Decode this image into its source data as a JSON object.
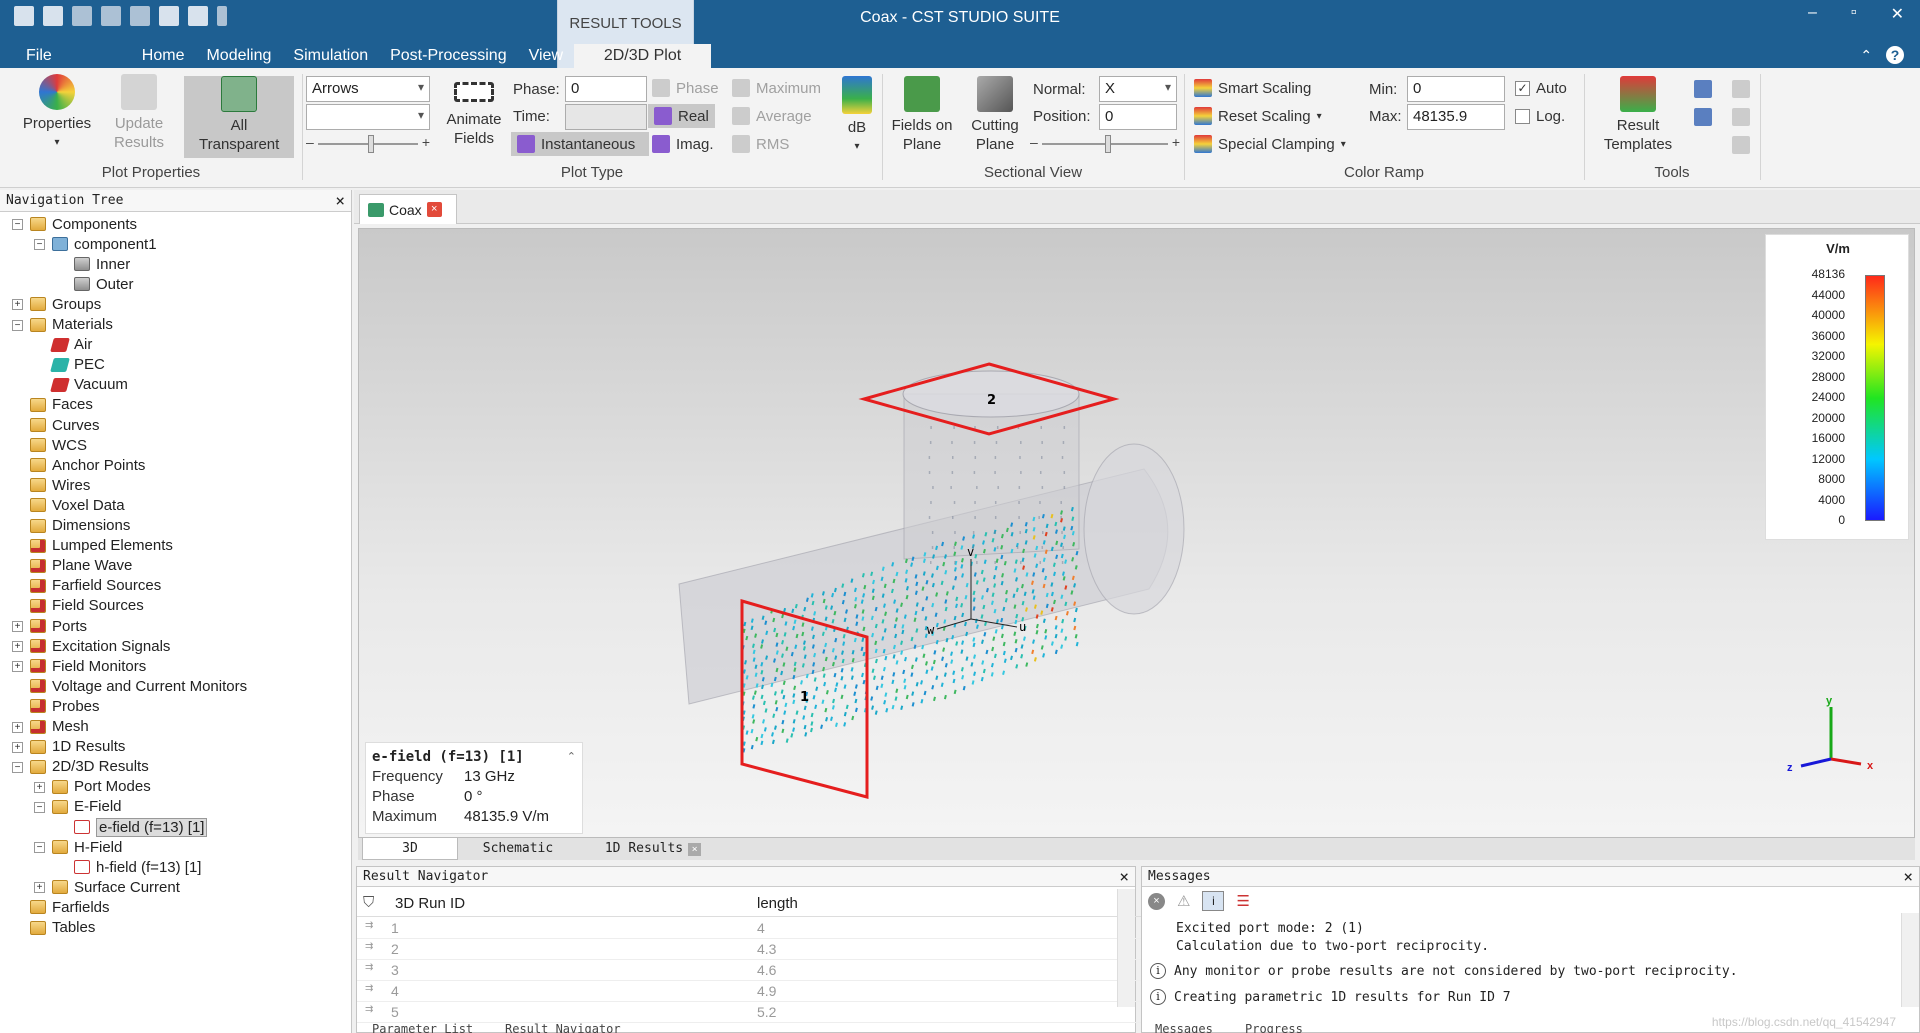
{
  "window": {
    "title": "Coax - CST STUDIO SUITE",
    "minimize": "–",
    "restore": "▫",
    "close": "✕",
    "ribbon_collapse": "⌃",
    "help": "?"
  },
  "context_tab": {
    "group": "RESULT TOOLS",
    "tab": "2D/3D Plot"
  },
  "menu": [
    "File",
    "Home",
    "Modeling",
    "Simulation",
    "Post-Processing",
    "View"
  ],
  "ribbon": {
    "plot_properties": {
      "label": "Plot Properties",
      "properties": "Properties",
      "update_results": "Update Results",
      "all_transparent": "All Transparent"
    },
    "plot_type": {
      "label": "Plot Type",
      "type_value": "Arrows",
      "second_value": "",
      "animate_fields": "Animate Fields",
      "phase_label": "Phase:",
      "phase_value": "0",
      "time_label": "Time:",
      "time_value": "",
      "instantaneous": "Instantaneous",
      "phase": "Phase",
      "real": "Real",
      "imag": "Imag.",
      "maximum": "Maximum",
      "average": "Average",
      "rms": "RMS",
      "db": "dB"
    },
    "sectional_view": {
      "label": "Sectional View",
      "fields_on_plane": "Fields on Plane",
      "cutting_plane": "Cutting Plane",
      "normal_label": "Normal:",
      "normal_value": "X",
      "position_label": "Position:",
      "position_value": "0"
    },
    "color_ramp": {
      "label": "Color Ramp",
      "smart_scaling": "Smart Scaling",
      "reset_scaling": "Reset Scaling",
      "special_clamping": "Special Clamping",
      "min_label": "Min:",
      "min_value": "0",
      "max_label": "Max:",
      "max_value": "48135.9",
      "auto": "Auto",
      "auto_checked": true,
      "log": "Log.",
      "log_checked": false
    },
    "tools": {
      "label": "Tools",
      "result_templates": "Result Templates"
    }
  },
  "nav_tree": {
    "title": "Navigation Tree",
    "items": [
      {
        "label": "Components",
        "level": 0,
        "exp": "−",
        "icon": "folder"
      },
      {
        "label": "component1",
        "level": 1,
        "exp": "−",
        "icon": "comp"
      },
      {
        "label": "Inner",
        "level": 2,
        "exp": "",
        "icon": "solid"
      },
      {
        "label": "Outer",
        "level": 2,
        "exp": "",
        "icon": "solid"
      },
      {
        "label": "Groups",
        "level": 0,
        "exp": "+",
        "icon": "folder"
      },
      {
        "label": "Materials",
        "level": 0,
        "exp": "−",
        "icon": "folder"
      },
      {
        "label": "Air",
        "level": 1,
        "exp": "",
        "icon": "mat-red"
      },
      {
        "label": "PEC",
        "level": 1,
        "exp": "",
        "icon": "mat-teal"
      },
      {
        "label": "Vacuum",
        "level": 1,
        "exp": "",
        "icon": "mat-red"
      },
      {
        "label": "Faces",
        "level": 0,
        "exp": "",
        "icon": "folder"
      },
      {
        "label": "Curves",
        "level": 0,
        "exp": "",
        "icon": "folder"
      },
      {
        "label": "WCS",
        "level": 0,
        "exp": "",
        "icon": "folder"
      },
      {
        "label": "Anchor Points",
        "level": 0,
        "exp": "",
        "icon": "folder"
      },
      {
        "label": "Wires",
        "level": 0,
        "exp": "",
        "icon": "folder"
      },
      {
        "label": "Voxel Data",
        "level": 0,
        "exp": "",
        "icon": "folder"
      },
      {
        "label": "Dimensions",
        "level": 0,
        "exp": "",
        "icon": "folder"
      },
      {
        "label": "Lumped Elements",
        "level": 0,
        "exp": "",
        "icon": "folder-red"
      },
      {
        "label": "Plane Wave",
        "level": 0,
        "exp": "",
        "icon": "folder-red"
      },
      {
        "label": "Farfield Sources",
        "level": 0,
        "exp": "",
        "icon": "folder-red"
      },
      {
        "label": "Field Sources",
        "level": 0,
        "exp": "",
        "icon": "folder-red"
      },
      {
        "label": "Ports",
        "level": 0,
        "exp": "+",
        "icon": "folder-red"
      },
      {
        "label": "Excitation Signals",
        "level": 0,
        "exp": "+",
        "icon": "folder-red"
      },
      {
        "label": "Field Monitors",
        "level": 0,
        "exp": "+",
        "icon": "folder-red"
      },
      {
        "label": "Voltage and Current Monitors",
        "level": 0,
        "exp": "",
        "icon": "folder-red"
      },
      {
        "label": "Probes",
        "level": 0,
        "exp": "",
        "icon": "folder-red"
      },
      {
        "label": "Mesh",
        "level": 0,
        "exp": "+",
        "icon": "folder-red"
      },
      {
        "label": "1D Results",
        "level": 0,
        "exp": "+",
        "icon": "folder"
      },
      {
        "label": "2D/3D Results",
        "level": 0,
        "exp": "−",
        "icon": "folder"
      },
      {
        "label": "Port Modes",
        "level": 1,
        "exp": "+",
        "icon": "folder"
      },
      {
        "label": "E-Field",
        "level": 1,
        "exp": "−",
        "icon": "folder"
      },
      {
        "label": "e-field (f=13) [1]",
        "level": 2,
        "exp": "",
        "icon": "field",
        "selected": true
      },
      {
        "label": "H-Field",
        "level": 1,
        "exp": "−",
        "icon": "folder"
      },
      {
        "label": "h-field (f=13) [1]",
        "level": 2,
        "exp": "",
        "icon": "field"
      },
      {
        "label": "Surface Current",
        "level": 1,
        "exp": "+",
        "icon": "folder"
      },
      {
        "label": "Farfields",
        "level": 0,
        "exp": "",
        "icon": "folder"
      },
      {
        "label": "Tables",
        "level": 0,
        "exp": "",
        "icon": "folder"
      }
    ]
  },
  "doc_tab": {
    "label": "Coax",
    "close": "×"
  },
  "scene": {
    "port1_label": "1",
    "port2_label": "2",
    "axis_v": "v",
    "axis_w": "w",
    "axis_u": "u",
    "triad_x": "x",
    "triad_y": "y",
    "triad_z": "z"
  },
  "colorbar": {
    "unit": "V/m",
    "ticks": [
      "48136",
      "44000",
      "40000",
      "36000",
      "32000",
      "28000",
      "24000",
      "20000",
      "16000",
      "12000",
      "8000",
      "4000",
      "0"
    ]
  },
  "info": {
    "title": "e-field (f=13) [1]",
    "rows": [
      {
        "k": "Frequency",
        "v": "13 GHz"
      },
      {
        "k": "Phase",
        "v": "0 °"
      },
      {
        "k": "Maximum",
        "v": "48135.9 V/m"
      }
    ]
  },
  "view_tabs": {
    "tab_3d": "3D",
    "schematic": "Schematic",
    "results_1d": "1D Results"
  },
  "result_navigator": {
    "title": "Result Navigator",
    "columns": [
      "3D Run ID",
      "length"
    ],
    "rows": [
      {
        "id": "1",
        "length": "4"
      },
      {
        "id": "2",
        "length": "4.3"
      },
      {
        "id": "3",
        "length": "4.6"
      },
      {
        "id": "4",
        "length": "4.9"
      },
      {
        "id": "5",
        "length": "5.2"
      }
    ],
    "tab_params": "Parameter List",
    "tab_rn": "Result Navigator"
  },
  "messages": {
    "title": "Messages",
    "lines": [
      {
        "icon": "",
        "text": "Excited port mode: 2 (1)"
      },
      {
        "icon": "",
        "text": "Calculation due to two-port reciprocity."
      },
      {
        "icon": "i",
        "text": "Any monitor or probe results are not considered by two-port reciprocity."
      },
      {
        "icon": "i",
        "text": "Creating parametric 1D results for Run ID 7"
      }
    ],
    "tab_messages": "Messages",
    "tab_progress": "Progress"
  },
  "watermark": "https://blog.csdn.net/qq_41542947"
}
